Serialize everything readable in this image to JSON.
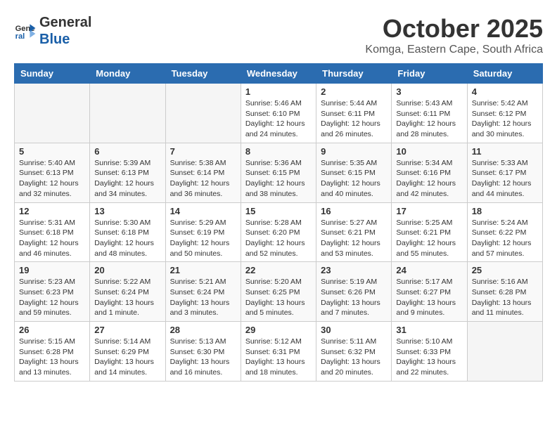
{
  "header": {
    "logo_line1": "General",
    "logo_line2": "Blue",
    "month": "October 2025",
    "location": "Komga, Eastern Cape, South Africa"
  },
  "weekdays": [
    "Sunday",
    "Monday",
    "Tuesday",
    "Wednesday",
    "Thursday",
    "Friday",
    "Saturday"
  ],
  "weeks": [
    [
      {
        "day": "",
        "info": ""
      },
      {
        "day": "",
        "info": ""
      },
      {
        "day": "",
        "info": ""
      },
      {
        "day": "1",
        "info": "Sunrise: 5:46 AM\nSunset: 6:10 PM\nDaylight: 12 hours\nand 24 minutes."
      },
      {
        "day": "2",
        "info": "Sunrise: 5:44 AM\nSunset: 6:11 PM\nDaylight: 12 hours\nand 26 minutes."
      },
      {
        "day": "3",
        "info": "Sunrise: 5:43 AM\nSunset: 6:11 PM\nDaylight: 12 hours\nand 28 minutes."
      },
      {
        "day": "4",
        "info": "Sunrise: 5:42 AM\nSunset: 6:12 PM\nDaylight: 12 hours\nand 30 minutes."
      }
    ],
    [
      {
        "day": "5",
        "info": "Sunrise: 5:40 AM\nSunset: 6:13 PM\nDaylight: 12 hours\nand 32 minutes."
      },
      {
        "day": "6",
        "info": "Sunrise: 5:39 AM\nSunset: 6:13 PM\nDaylight: 12 hours\nand 34 minutes."
      },
      {
        "day": "7",
        "info": "Sunrise: 5:38 AM\nSunset: 6:14 PM\nDaylight: 12 hours\nand 36 minutes."
      },
      {
        "day": "8",
        "info": "Sunrise: 5:36 AM\nSunset: 6:15 PM\nDaylight: 12 hours\nand 38 minutes."
      },
      {
        "day": "9",
        "info": "Sunrise: 5:35 AM\nSunset: 6:15 PM\nDaylight: 12 hours\nand 40 minutes."
      },
      {
        "day": "10",
        "info": "Sunrise: 5:34 AM\nSunset: 6:16 PM\nDaylight: 12 hours\nand 42 minutes."
      },
      {
        "day": "11",
        "info": "Sunrise: 5:33 AM\nSunset: 6:17 PM\nDaylight: 12 hours\nand 44 minutes."
      }
    ],
    [
      {
        "day": "12",
        "info": "Sunrise: 5:31 AM\nSunset: 6:18 PM\nDaylight: 12 hours\nand 46 minutes."
      },
      {
        "day": "13",
        "info": "Sunrise: 5:30 AM\nSunset: 6:18 PM\nDaylight: 12 hours\nand 48 minutes."
      },
      {
        "day": "14",
        "info": "Sunrise: 5:29 AM\nSunset: 6:19 PM\nDaylight: 12 hours\nand 50 minutes."
      },
      {
        "day": "15",
        "info": "Sunrise: 5:28 AM\nSunset: 6:20 PM\nDaylight: 12 hours\nand 52 minutes."
      },
      {
        "day": "16",
        "info": "Sunrise: 5:27 AM\nSunset: 6:21 PM\nDaylight: 12 hours\nand 53 minutes."
      },
      {
        "day": "17",
        "info": "Sunrise: 5:25 AM\nSunset: 6:21 PM\nDaylight: 12 hours\nand 55 minutes."
      },
      {
        "day": "18",
        "info": "Sunrise: 5:24 AM\nSunset: 6:22 PM\nDaylight: 12 hours\nand 57 minutes."
      }
    ],
    [
      {
        "day": "19",
        "info": "Sunrise: 5:23 AM\nSunset: 6:23 PM\nDaylight: 12 hours\nand 59 minutes."
      },
      {
        "day": "20",
        "info": "Sunrise: 5:22 AM\nSunset: 6:24 PM\nDaylight: 13 hours\nand 1 minute."
      },
      {
        "day": "21",
        "info": "Sunrise: 5:21 AM\nSunset: 6:24 PM\nDaylight: 13 hours\nand 3 minutes."
      },
      {
        "day": "22",
        "info": "Sunrise: 5:20 AM\nSunset: 6:25 PM\nDaylight: 13 hours\nand 5 minutes."
      },
      {
        "day": "23",
        "info": "Sunrise: 5:19 AM\nSunset: 6:26 PM\nDaylight: 13 hours\nand 7 minutes."
      },
      {
        "day": "24",
        "info": "Sunrise: 5:17 AM\nSunset: 6:27 PM\nDaylight: 13 hours\nand 9 minutes."
      },
      {
        "day": "25",
        "info": "Sunrise: 5:16 AM\nSunset: 6:28 PM\nDaylight: 13 hours\nand 11 minutes."
      }
    ],
    [
      {
        "day": "26",
        "info": "Sunrise: 5:15 AM\nSunset: 6:28 PM\nDaylight: 13 hours\nand 13 minutes."
      },
      {
        "day": "27",
        "info": "Sunrise: 5:14 AM\nSunset: 6:29 PM\nDaylight: 13 hours\nand 14 minutes."
      },
      {
        "day": "28",
        "info": "Sunrise: 5:13 AM\nSunset: 6:30 PM\nDaylight: 13 hours\nand 16 minutes."
      },
      {
        "day": "29",
        "info": "Sunrise: 5:12 AM\nSunset: 6:31 PM\nDaylight: 13 hours\nand 18 minutes."
      },
      {
        "day": "30",
        "info": "Sunrise: 5:11 AM\nSunset: 6:32 PM\nDaylight: 13 hours\nand 20 minutes."
      },
      {
        "day": "31",
        "info": "Sunrise: 5:10 AM\nSunset: 6:33 PM\nDaylight: 13 hours\nand 22 minutes."
      },
      {
        "day": "",
        "info": ""
      }
    ]
  ]
}
